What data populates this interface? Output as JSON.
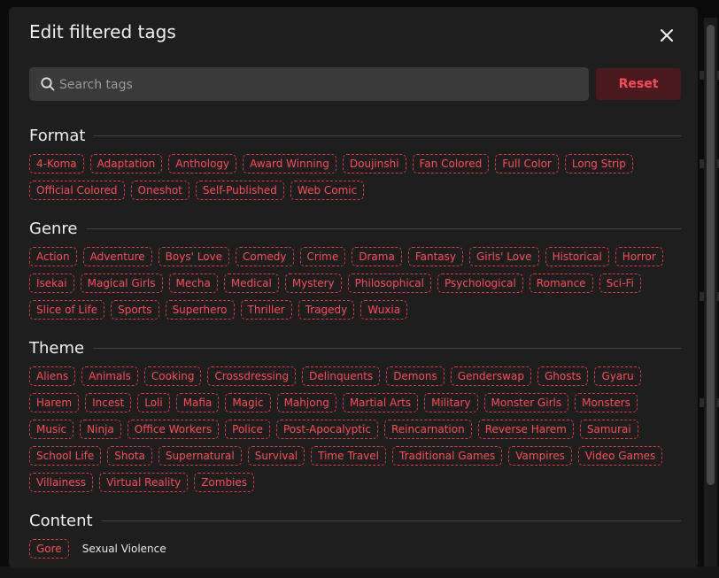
{
  "dialog": {
    "title": "Edit filtered tags",
    "search_placeholder": "Search tags",
    "search_value": "",
    "reset_label": "Reset"
  },
  "colors": {
    "accent": "#ff4b55",
    "chip_border": "#e03a44",
    "reset_bg": "#4a1a1f",
    "panel_bg": "#1e1e1e"
  },
  "sections": [
    {
      "title": "Format",
      "tags": [
        "4-Koma",
        "Adaptation",
        "Anthology",
        "Award Winning",
        "Doujinshi",
        "Fan Colored",
        "Full Color",
        "Long Strip",
        "Official Colored",
        "Oneshot",
        "Self-Published",
        "Web Comic"
      ]
    },
    {
      "title": "Genre",
      "tags": [
        "Action",
        "Adventure",
        "Boys' Love",
        "Comedy",
        "Crime",
        "Drama",
        "Fantasy",
        "Girls' Love",
        "Historical",
        "Horror",
        "Isekai",
        "Magical Girls",
        "Mecha",
        "Medical",
        "Mystery",
        "Philosophical",
        "Psychological",
        "Romance",
        "Sci-Fi",
        "Slice of Life",
        "Sports",
        "Superhero",
        "Thriller",
        "Tragedy",
        "Wuxia"
      ]
    },
    {
      "title": "Theme",
      "tags": [
        "Aliens",
        "Animals",
        "Cooking",
        "Crossdressing",
        "Delinquents",
        "Demons",
        "Genderswap",
        "Ghosts",
        "Gyaru",
        "Harem",
        "Incest",
        "Loli",
        "Mafia",
        "Magic",
        "Mahjong",
        "Martial Arts",
        "Military",
        "Monster Girls",
        "Monsters",
        "Music",
        "Ninja",
        "Office Workers",
        "Police",
        "Post-Apocalyptic",
        "Reincarnation",
        "Reverse Harem",
        "Samurai",
        "School Life",
        "Shota",
        "Supernatural",
        "Survival",
        "Time Travel",
        "Traditional Games",
        "Vampires",
        "Video Games",
        "Villainess",
        "Virtual Reality",
        "Zombies"
      ]
    },
    {
      "title": "Content",
      "tags": [
        "Gore",
        "Sexual Violence"
      ],
      "selected": [
        "Gore"
      ]
    }
  ]
}
